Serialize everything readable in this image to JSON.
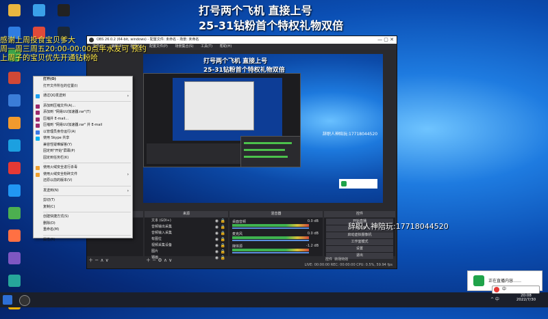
{
  "overlay": {
    "headline_line1": "打号两个飞机 直接上号",
    "headline_line2": "25-31钻粉首个特权礼物双倍",
    "notice_line1": "感谢上周投食宝贝爹大",
    "notice_line2": "周一周三周五20:00-00:00点半水友可 预约",
    "notice_line3": "上周子的宝贝优先开通钻粉哈",
    "contact": "辞职人神陪玩:17718044520"
  },
  "desktop_icons": [
    {
      "label": "",
      "color": "#e9b640"
    },
    {
      "label": "",
      "color": "#3aa0e8"
    },
    {
      "label": "",
      "color": "#222"
    },
    {
      "label": "",
      "color": "#2f7de1"
    },
    {
      "label": "",
      "color": "#e04a3a"
    },
    {
      "label": "",
      "color": "#1b2838"
    },
    {
      "label": "",
      "color": "#3da34a"
    },
    {
      "label": "",
      "color": "#d14836"
    },
    {
      "label": "",
      "color": "#3b7dd8"
    },
    {
      "label": "",
      "color": "#f29a2e"
    },
    {
      "label": "",
      "color": "#1ca0e0"
    },
    {
      "label": "",
      "color": "#e53935"
    },
    {
      "label": "",
      "color": "#2196f3"
    },
    {
      "label": "",
      "color": "#4caf50"
    },
    {
      "label": "",
      "color": "#ff7043"
    },
    {
      "label": "",
      "color": "#7e57c2"
    },
    {
      "label": "",
      "color": "#26a69a"
    },
    {
      "label": "",
      "color": "#ffb300"
    }
  ],
  "obs": {
    "title": "OBS 26.0.2 (64-bit, windows) - 配置文件: 未命名 - 场景: 未命名",
    "menus": [
      "文件(F)",
      "编辑(E)",
      "视图(V)",
      "配置文件(P)",
      "场景集合(S)",
      "工具(T)",
      "帮助(H)"
    ],
    "preview_headline1": "打号两个飞机 直接上号",
    "preview_headline2": "25-31钻粉首个特权礼物双倍",
    "preview_contact": "辞职人神陪玩:17718044520",
    "docks": {
      "scenes": "场景",
      "sources": "来源",
      "mixer": "混音器",
      "transitions": "转场特效",
      "controls": "控件"
    },
    "sources": [
      "文本 (GDI+)",
      "音频输出采集",
      "音频输入采集",
      "有图位",
      "视频采集设备",
      "图片",
      "锚画"
    ],
    "mixer": [
      {
        "name": "桌面音频",
        "db": "0.0 dB"
      },
      {
        "name": "麦克风",
        "db": "0.0 dB"
      },
      {
        "name": "媒体源",
        "db": "-1.2 dB"
      }
    ],
    "controls": [
      "开始直播",
      "开始录制",
      "启动虚拟摄像机",
      "工作室模式",
      "设置",
      "退出"
    ],
    "status": "LIVE: 00:00:00   REC: 00:00:00   CPU: 0.5%, 59.94 fps"
  },
  "context_menu": {
    "items": [
      {
        "label": "打开(O)",
        "bold": true,
        "icon": "",
        "sub": false
      },
      {
        "label": "打开文件所在的位置(I)",
        "icon": "",
        "sub": false
      },
      {
        "sep": true
      },
      {
        "label": "通过QQ发送到",
        "icon": "qq",
        "sub": true
      },
      {
        "sep": true
      },
      {
        "label": "添加到压缩文件(A)...",
        "icon": "rar",
        "sub": false
      },
      {
        "label": "添加到 \"网易UU加速器.rar\"(T)",
        "icon": "rar",
        "sub": false
      },
      {
        "label": "压缩并 E-mail...",
        "icon": "rar",
        "sub": false
      },
      {
        "label": "压缩到 \"网易UU加速器.rar\" 并 E-mail",
        "icon": "rar",
        "sub": false
      },
      {
        "label": "以管理员身份运行(A)",
        "icon": "shield",
        "sub": false
      },
      {
        "label": "使用 Skype 共享",
        "icon": "skype",
        "sub": false
      },
      {
        "label": "兼容性疑难解答(Y)",
        "icon": "",
        "sub": false
      },
      {
        "label": "固定到\"开始\"屏幕(P)",
        "icon": "",
        "sub": false
      },
      {
        "label": "固定到任务栏(K)",
        "icon": "",
        "sub": false
      },
      {
        "sep": true
      },
      {
        "label": "使用火绒安全进行杀毒",
        "icon": "huorong",
        "sub": false
      },
      {
        "label": "使用火绒安全粉碎文件",
        "icon": "huorong",
        "sub": true
      },
      {
        "label": "还原以前的版本(V)",
        "icon": "",
        "sub": false
      },
      {
        "sep": true
      },
      {
        "label": "发送到(N)",
        "icon": "",
        "sub": true
      },
      {
        "sep": true
      },
      {
        "label": "剪切(T)",
        "icon": "",
        "sub": false
      },
      {
        "label": "复制(C)",
        "icon": "",
        "sub": false
      },
      {
        "sep": true
      },
      {
        "label": "创建快捷方式(S)",
        "icon": "",
        "sub": false
      },
      {
        "label": "删除(D)",
        "icon": "",
        "sub": false
      },
      {
        "label": "重命名(M)",
        "icon": "",
        "sub": false
      },
      {
        "sep": true
      },
      {
        "label": "属性(R)",
        "icon": "",
        "sub": false
      }
    ]
  },
  "toast": {
    "text": "正在直播内容……"
  },
  "taskbar": {
    "time": "20:08",
    "date": "2022/7/30",
    "ime": "中",
    "tray_text": "^ 中"
  }
}
